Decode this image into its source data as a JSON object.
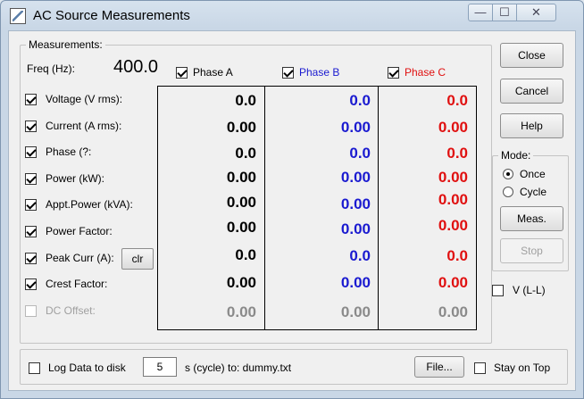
{
  "window": {
    "title": "AC Source Measurements",
    "title_buttons": {
      "minimize": "—",
      "maximize": "☐",
      "close": "✕"
    }
  },
  "measurements": {
    "group_label": "Measurements:",
    "freq_label": "Freq (Hz):",
    "freq_value": "400.0",
    "phases": [
      {
        "label": "Phase A",
        "checked": true,
        "color": "#000000"
      },
      {
        "label": "Phase B",
        "checked": true,
        "color": "#1a1ad0"
      },
      {
        "label": "Phase C",
        "checked": true,
        "color": "#e01010"
      }
    ],
    "rows": [
      {
        "label": "Voltage (V rms):",
        "checked": true,
        "a": "0.0",
        "b": "0.0",
        "c": "0.0"
      },
      {
        "label": "Current (A rms):",
        "checked": true,
        "a": "0.00",
        "b": "0.00",
        "c": "0.00"
      },
      {
        "label": "Phase (?:",
        "checked": true,
        "a": "0.0",
        "b": "0.0",
        "c": "0.0"
      },
      {
        "label": "Power (kW):",
        "checked": true,
        "a": "0.00",
        "b": "0.00",
        "c": "0.00"
      },
      {
        "label": "Appt.Power (kVA):",
        "checked": true,
        "a": "0.00",
        "b": "0.00",
        "c": "0.00"
      },
      {
        "label": "Power Factor:",
        "checked": true,
        "a": "0.00",
        "b": "0.00",
        "c": "0.00"
      },
      {
        "label": "Peak Curr (A):",
        "checked": true,
        "a": "0.0",
        "b": "0.0",
        "c": "0.0"
      },
      {
        "label": "Crest Factor:",
        "checked": true,
        "a": "0.00",
        "b": "0.00",
        "c": "0.00"
      },
      {
        "label": "DC Offset:",
        "checked": false,
        "disabled": true,
        "a": "0.00",
        "b": "0.00",
        "c": "0.00"
      }
    ],
    "clr_label": "clr"
  },
  "buttons": {
    "close": "Close",
    "cancel": "Cancel",
    "help": "Help",
    "meas": "Meas.",
    "stop": "Stop"
  },
  "mode": {
    "label": "Mode:",
    "options": [
      {
        "label": "Once",
        "selected": true
      },
      {
        "label": "Cycle",
        "selected": false
      }
    ]
  },
  "v_ll": {
    "label": "V (L-L)",
    "checked": false
  },
  "bottom": {
    "log_label": "Log Data to disk",
    "log_checked": false,
    "interval_value": "5",
    "interval_suffix": "s (cycle)  to: dummy.txt",
    "file_button": "File...",
    "stay_on_top_label": "Stay on Top",
    "stay_on_top_checked": false
  },
  "colors": {
    "phase_a": "#000000",
    "phase_b": "#1a1ad0",
    "phase_c": "#e01010",
    "disabled": "#8a8a8a"
  }
}
